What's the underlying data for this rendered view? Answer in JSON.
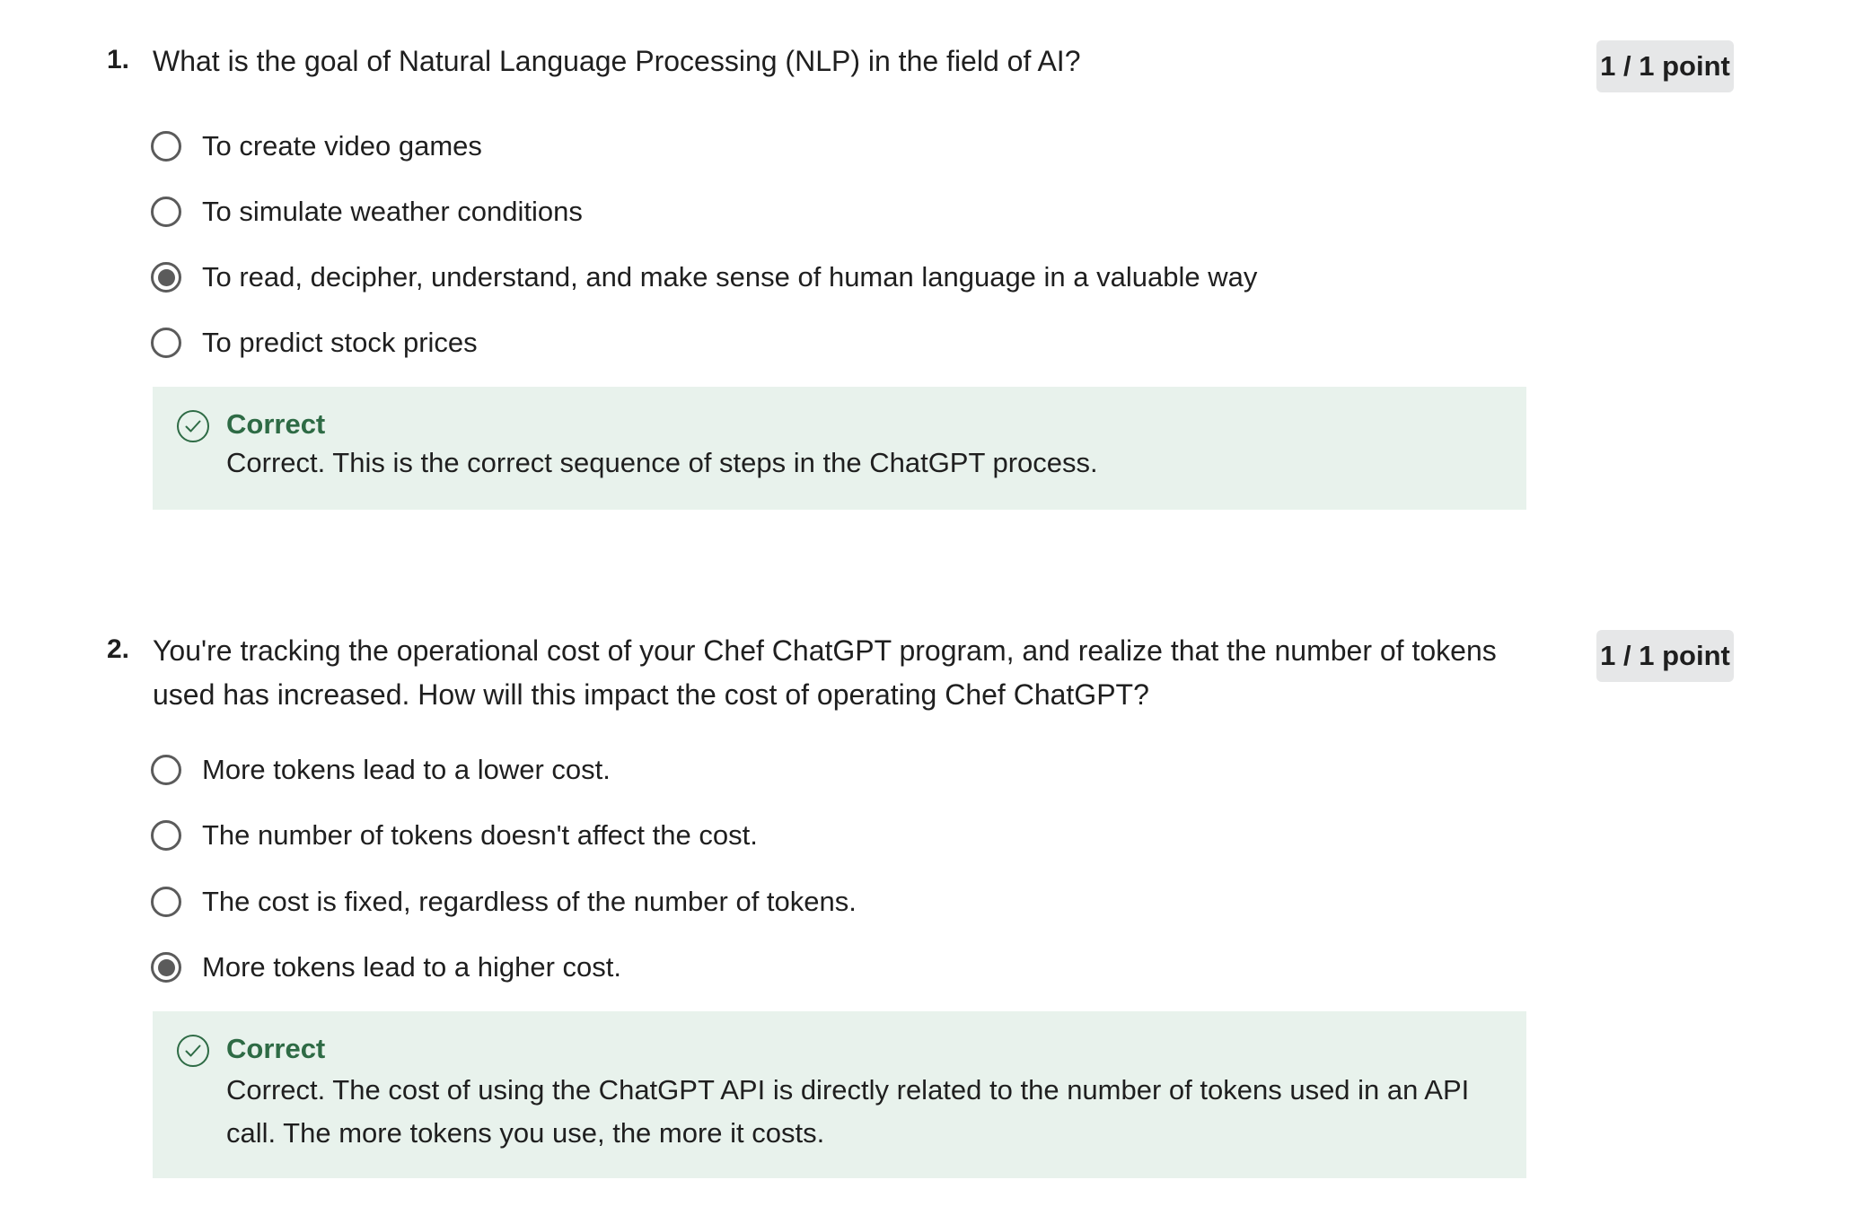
{
  "questions": [
    {
      "number": "1.",
      "text": "What is the goal of Natural Language Processing (NLP) in the field of AI?",
      "points": "1 / 1 point",
      "options": [
        {
          "label": "To create video games",
          "selected": false
        },
        {
          "label": "To simulate weather conditions",
          "selected": false
        },
        {
          "label": "To read, decipher, understand, and make sense of human language in a valuable way",
          "selected": true
        },
        {
          "label": "To predict stock prices",
          "selected": false
        }
      ],
      "feedback": {
        "title": "Correct",
        "body": "Correct. This is the correct sequence of steps in the ChatGPT process.",
        "icon": "check-circle-icon"
      }
    },
    {
      "number": "2.",
      "text": "You're tracking the operational cost of your Chef ChatGPT program, and realize that the number of tokens used has increased. How will this impact the cost of operating Chef ChatGPT?",
      "points": "1 / 1 point",
      "options": [
        {
          "label": "More tokens lead to a lower cost.",
          "selected": false
        },
        {
          "label": "The number of tokens doesn't affect the cost.",
          "selected": false
        },
        {
          "label": "The cost is fixed, regardless of the number of tokens.",
          "selected": false
        },
        {
          "label": "More tokens lead to a higher cost.",
          "selected": true
        }
      ],
      "feedback": {
        "title": "Correct",
        "body": "Correct. The cost of using the ChatGPT API is directly related to the number of tokens used in an API call. The more tokens you use, the more it costs.",
        "icon": "check-circle-icon"
      }
    }
  ],
  "colors": {
    "feedback_background": "#e8f2ec",
    "correct_green": "#2e6b45",
    "badge_background": "#e6e7e8",
    "radio_gray": "#5b5b5b"
  }
}
